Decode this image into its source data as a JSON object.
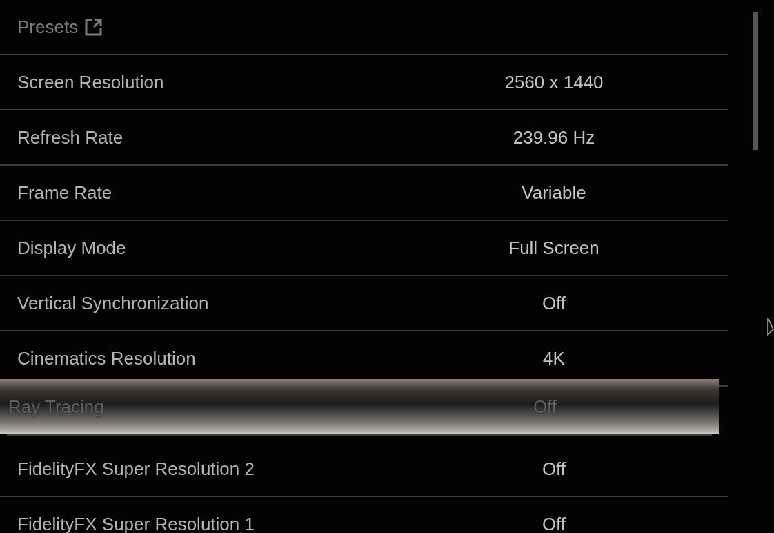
{
  "header": {
    "label": "Presets"
  },
  "settings": [
    {
      "label": "Screen Resolution",
      "value": "2560 x 1440",
      "selected": false
    },
    {
      "label": "Refresh Rate",
      "value": "239.96 Hz",
      "selected": false
    },
    {
      "label": "Frame Rate",
      "value": "Variable",
      "selected": false
    },
    {
      "label": "Display Mode",
      "value": "Full Screen",
      "selected": false
    },
    {
      "label": "Vertical Synchronization",
      "value": "Off",
      "selected": false
    },
    {
      "label": "Cinematics Resolution",
      "value": "4K",
      "selected": false
    },
    {
      "label": "Ray Tracing",
      "value": "Off",
      "selected": true
    },
    {
      "label": "FidelityFX Super Resolution 2",
      "value": "Off",
      "selected": false
    },
    {
      "label": "FidelityFX Super Resolution 1",
      "value": "Off",
      "selected": false
    }
  ]
}
